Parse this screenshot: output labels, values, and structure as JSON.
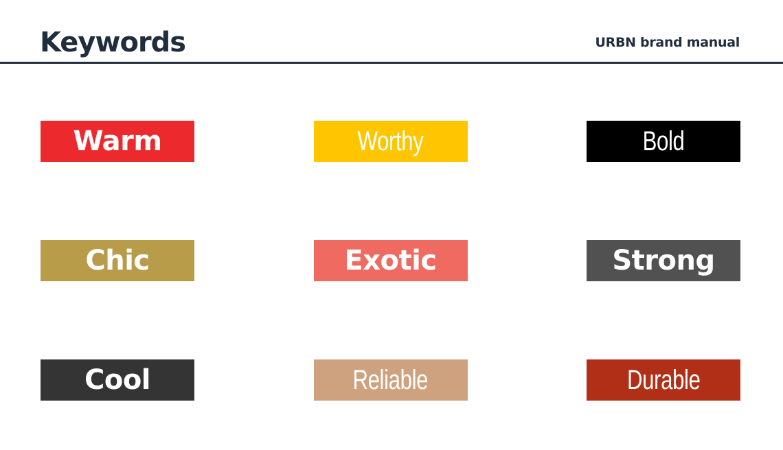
{
  "header": {
    "title": "Keywords",
    "brand": "URBN brand manual"
  },
  "keywords": [
    {
      "label": "Warm",
      "color": "#ec2a2e",
      "weight": "bold"
    },
    {
      "label": "Worthy",
      "color": "#ffc600",
      "weight": "light"
    },
    {
      "label": "Bold",
      "color": "#000000",
      "weight": "light"
    },
    {
      "label": "Chic",
      "color": "#b89c4a",
      "weight": "bold"
    },
    {
      "label": "Exotic",
      "color": "#ef6a60",
      "weight": "bold"
    },
    {
      "label": "Strong",
      "color": "#515151",
      "weight": "bold"
    },
    {
      "label": "Cool",
      "color": "#343434",
      "weight": "bold"
    },
    {
      "label": "Reliable",
      "color": "#cea17f",
      "weight": "light"
    },
    {
      "label": "Durable",
      "color": "#b12f17",
      "weight": "light"
    }
  ]
}
